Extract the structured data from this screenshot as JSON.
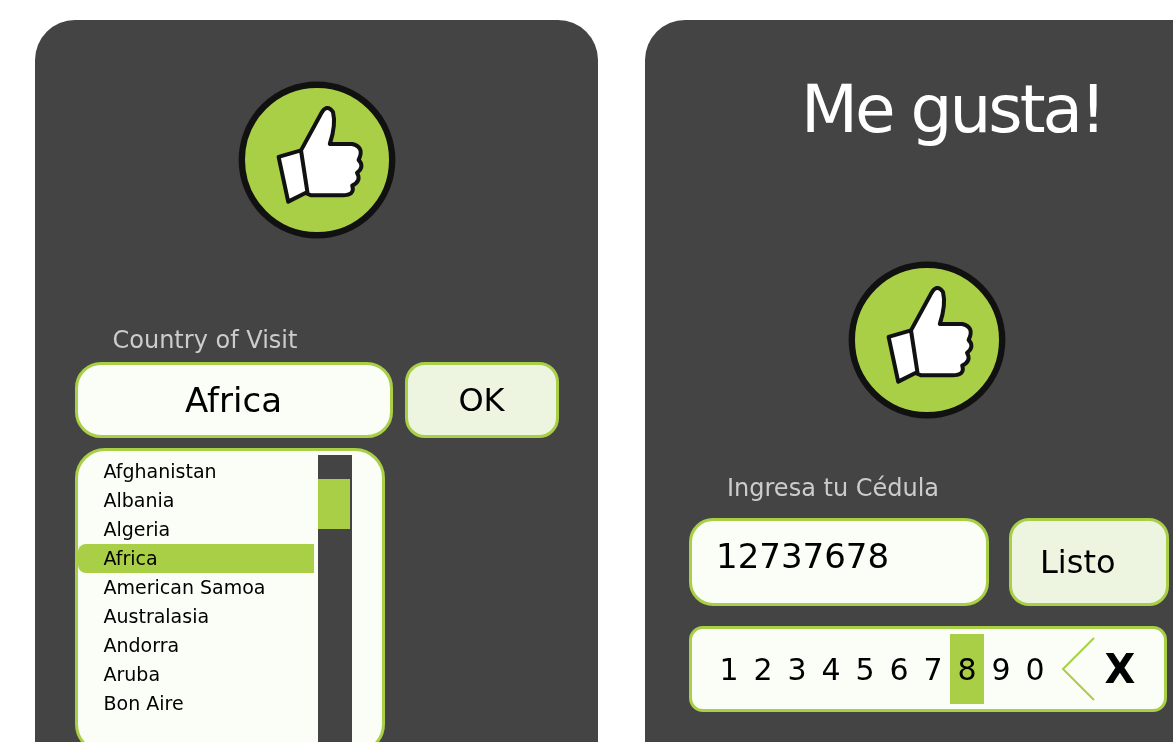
{
  "country_panel": {
    "label": "Country of Visit",
    "field": {
      "value": "Africa"
    },
    "ok_button": "OK",
    "list": [
      {
        "name": "Afghanistan",
        "selected": false
      },
      {
        "name": "Albania",
        "selected": false
      },
      {
        "name": "Algeria",
        "selected": false
      },
      {
        "name": "Africa",
        "selected": true
      },
      {
        "name": "American Samoa",
        "selected": false
      },
      {
        "name": "Australasia",
        "selected": false
      },
      {
        "name": "Andorra",
        "selected": false
      },
      {
        "name": "Aruba",
        "selected": false
      },
      {
        "name": "Bon Aire",
        "selected": false
      }
    ]
  },
  "id_panel": {
    "title": "Me gusta!",
    "label": "Ingresa tu Cédula",
    "field": {
      "value": "12737678"
    },
    "done_button": "Listo",
    "keys": [
      {
        "label": "1",
        "selected": false
      },
      {
        "label": "2",
        "selected": false
      },
      {
        "label": "3",
        "selected": false
      },
      {
        "label": "4",
        "selected": false
      },
      {
        "label": "5",
        "selected": false
      },
      {
        "label": "6",
        "selected": false
      },
      {
        "label": "7",
        "selected": false
      },
      {
        "label": "8",
        "selected": true
      },
      {
        "label": "9",
        "selected": false
      },
      {
        "label": "0",
        "selected": false
      }
    ],
    "clear_key": "X"
  }
}
